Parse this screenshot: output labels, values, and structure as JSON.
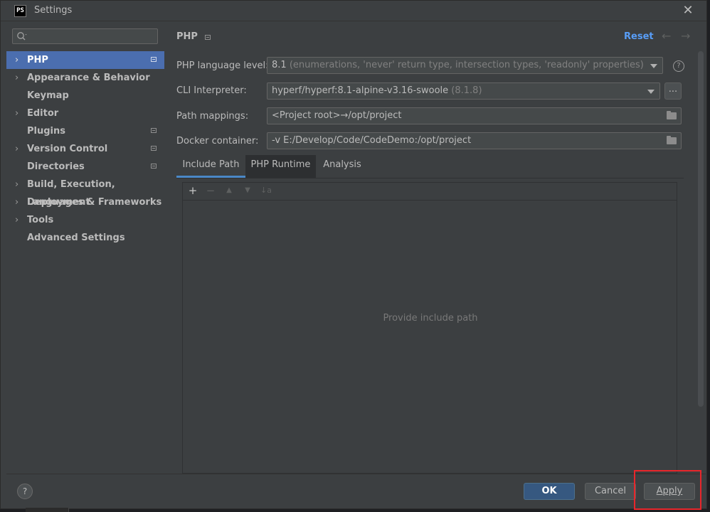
{
  "window": {
    "title": "Settings",
    "app_logo_text": "PS",
    "close_glyph": "✕"
  },
  "search": {
    "placeholder": "",
    "value": ""
  },
  "sidebar": {
    "items": [
      {
        "label": "PHP",
        "chevron": "›",
        "selected": true,
        "project_icon": true
      },
      {
        "label": "Appearance & Behavior",
        "chevron": "›"
      },
      {
        "label": "Keymap",
        "chevron": ""
      },
      {
        "label": "Editor",
        "chevron": "›"
      },
      {
        "label": "Plugins",
        "chevron": "",
        "project_icon": true
      },
      {
        "label": "Version Control",
        "chevron": "›",
        "project_icon": true
      },
      {
        "label": "Directories",
        "chevron": "",
        "project_icon": true
      },
      {
        "label": "Build, Execution, Deployment",
        "chevron": "›"
      },
      {
        "label": "Languages & Frameworks",
        "chevron": "›"
      },
      {
        "label": "Tools",
        "chevron": "›"
      },
      {
        "label": "Advanced Settings",
        "chevron": ""
      }
    ]
  },
  "header": {
    "title": "PHP",
    "reset_label": "Reset",
    "back_glyph": "←",
    "forward_glyph": "→"
  },
  "form": {
    "language_level": {
      "label": "PHP language level:",
      "value": "8.1",
      "detail": "(enumerations, 'never' return type, intersection types, 'readonly' properties)"
    },
    "cli_interpreter": {
      "label": "CLI Interpreter:",
      "value": "hyperf/hyperf:8.1-alpine-v3.16-swoole",
      "detail": "(8.1.8)",
      "browse_label": "..."
    },
    "path_mappings": {
      "label": "Path mappings:",
      "value": "<Project root>→/opt/project"
    },
    "docker_container": {
      "label": "Docker container:",
      "value": "-v E:/Develop/Code/CodeDemo:/opt/project"
    },
    "help_glyph": "?"
  },
  "tabs": [
    {
      "label": "Include Path"
    },
    {
      "label": "PHP Runtime"
    },
    {
      "label": "Analysis"
    }
  ],
  "toolbar": {
    "add": "+",
    "remove": "−",
    "up": "▲",
    "down": "▼",
    "sort": "↓a"
  },
  "panel": {
    "empty_text": "Provide include path"
  },
  "footer": {
    "help_glyph": "?",
    "ok_label": "OK",
    "cancel_label": "Cancel",
    "apply_label": "Apply"
  },
  "colors": {
    "accent": "#4b6eaf",
    "link": "#589df6",
    "ok_button": "#365880",
    "highlight": "#e8262b"
  }
}
